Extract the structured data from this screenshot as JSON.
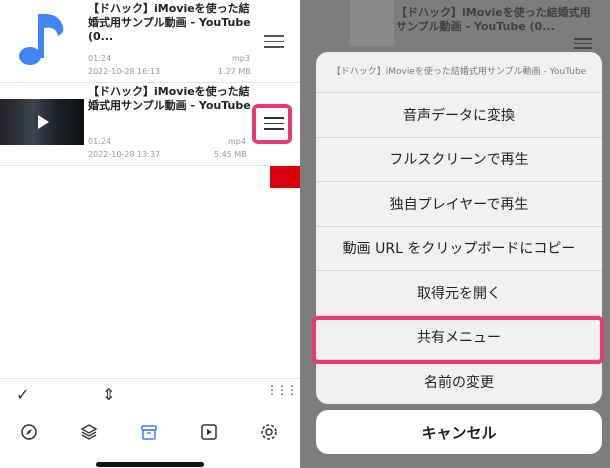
{
  "list": {
    "items": [
      {
        "title": "【ドハック】iMovieを使った結婚式用サンプル動画 - YouTube (0...",
        "duration": "01:24",
        "format": "mp3",
        "date": "2022-10-28 16:13",
        "size": "1.27 MB",
        "type": "audio"
      },
      {
        "title": "【ドハック】iMovieを使った結婚式用サンプル動画 - YouTube",
        "duration": "01:24",
        "format": "mp4",
        "date": "2022-10-28 13:37",
        "size": "5.45 MB",
        "type": "video"
      }
    ]
  },
  "toolbar": {
    "check_icon": "✓",
    "sort_icon": "⇕",
    "grid_icon": "⋮⋮⋮"
  },
  "nav": {
    "items": [
      "compass",
      "layers",
      "archive",
      "video",
      "settings"
    ]
  },
  "right": {
    "bg_title": "【ドハック】iMovieを使った結婚式用サンプル動画 - YouTube (0...",
    "sheet_title": "【ドハック】iMovieを使った結婚式用サンプル動画 - YouTube",
    "actions": [
      "音声データに変換",
      "フルスクリーンで再生",
      "独自プレイヤーで再生",
      "動画 URL をクリップボードにコピー",
      "取得元を開く",
      "共有メニュー",
      "名前の変更"
    ],
    "cancel": "キャンセル"
  },
  "colors": {
    "highlight": "#e83a73",
    "arrow": "#d9000d",
    "accent_blue": "#3b82f6"
  }
}
